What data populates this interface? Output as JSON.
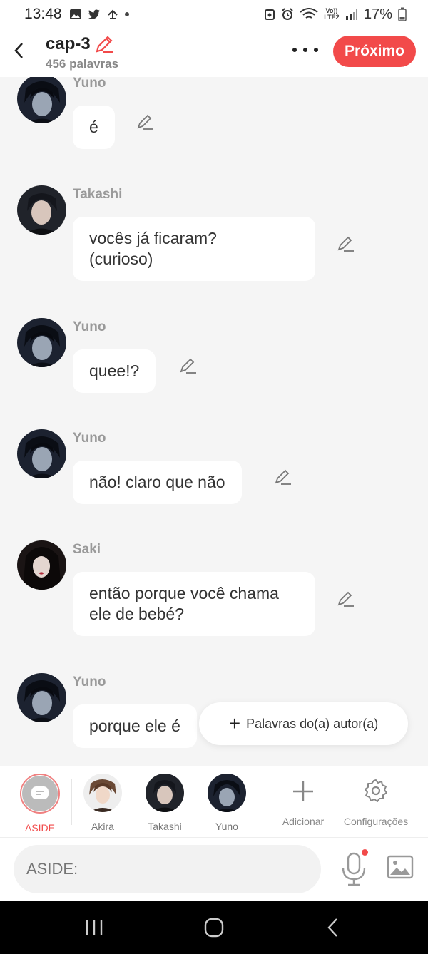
{
  "status_bar": {
    "time": "13:48",
    "battery": "17%",
    "network_label": "Vo)) LTE2"
  },
  "header": {
    "title": "cap-3",
    "word_count": "456 palavras",
    "next_label": "Próximo"
  },
  "messages": [
    {
      "sender": "Yuno",
      "text": "é"
    },
    {
      "sender": "Takashi",
      "text": "vocês já ficaram?\n(curioso)"
    },
    {
      "sender": "Yuno",
      "text": "quee!?"
    },
    {
      "sender": "Yuno",
      "text": "não! claro que não"
    },
    {
      "sender": "Saki",
      "text": "então porque você chama\nele de bebé?"
    },
    {
      "sender": "Yuno",
      "text": "porque ele é"
    }
  ],
  "author_words_label": "Palavras do(a) autor(a)",
  "characters": [
    {
      "label": "ASIDE"
    },
    {
      "label": "Akira"
    },
    {
      "label": "Takashi"
    },
    {
      "label": "Yuno"
    }
  ],
  "tools": {
    "add_label": "Adicionar",
    "settings_label": "Configurações"
  },
  "input": {
    "placeholder": "ASIDE:"
  },
  "colors": {
    "accent": "#f24a4a",
    "bubble": "#ffffff",
    "background": "#f5f5f5"
  }
}
